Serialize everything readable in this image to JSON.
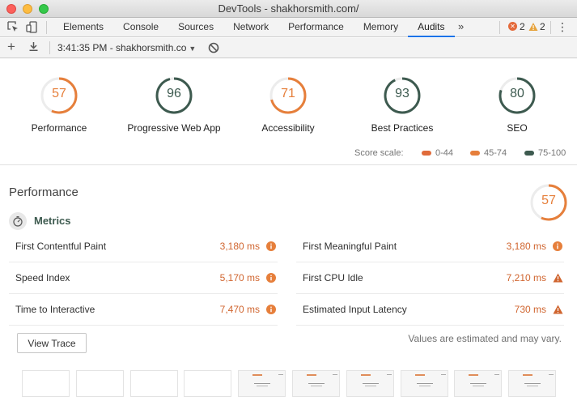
{
  "window": {
    "title": "DevTools - shakhorsmith.com/"
  },
  "tabs": [
    {
      "label": "Elements",
      "active": false
    },
    {
      "label": "Console",
      "active": false
    },
    {
      "label": "Sources",
      "active": false
    },
    {
      "label": "Network",
      "active": false
    },
    {
      "label": "Performance",
      "active": false
    },
    {
      "label": "Memory",
      "active": false
    },
    {
      "label": "Audits",
      "active": true
    }
  ],
  "tab_overflow": "»",
  "status": {
    "errors": "2",
    "warnings": "2"
  },
  "toolbar": {
    "report": "3:41:35 PM - shakhorsmith.co"
  },
  "gauges": [
    {
      "label": "Performance",
      "score": 57,
      "color": "#e67f3b"
    },
    {
      "label": "Progressive Web App",
      "score": 96,
      "color": "#3d5a4f"
    },
    {
      "label": "Accessibility",
      "score": 71,
      "color": "#e67f3b"
    },
    {
      "label": "Best Practices",
      "score": 93,
      "color": "#3d5a4f"
    },
    {
      "label": "SEO",
      "score": 80,
      "color": "#3d5a4f"
    }
  ],
  "score_scale": {
    "label": "Score scale:",
    "ranges": [
      {
        "label": "0-44",
        "color": "#e06b3a"
      },
      {
        "label": "45-74",
        "color": "#e67f3b"
      },
      {
        "label": "75-100",
        "color": "#3d5a4f"
      }
    ]
  },
  "performance": {
    "title": "Performance",
    "score": 57,
    "metrics_title": "Metrics",
    "metrics": [
      {
        "name": "First Contentful Paint",
        "value": "3,180 ms",
        "icon": "info-icon"
      },
      {
        "name": "First Meaningful Paint",
        "value": "3,180 ms",
        "icon": "info-icon"
      },
      {
        "name": "Speed Index",
        "value": "5,170 ms",
        "icon": "info-icon"
      },
      {
        "name": "First CPU Idle",
        "value": "7,210 ms",
        "icon": "warning-icon"
      },
      {
        "name": "Time to Interactive",
        "value": "7,470 ms",
        "icon": "info-icon"
      },
      {
        "name": "Estimated Input Latency",
        "value": "730 ms",
        "icon": "warning-icon"
      }
    ],
    "view_trace": "View Trace",
    "disclaimer": "Values are estimated and may vary."
  },
  "filmstrip": [
    {
      "loaded": false
    },
    {
      "loaded": false
    },
    {
      "loaded": false
    },
    {
      "loaded": false
    },
    {
      "loaded": true
    },
    {
      "loaded": true
    },
    {
      "loaded": true
    },
    {
      "loaded": true
    },
    {
      "loaded": true
    },
    {
      "loaded": true
    }
  ]
}
